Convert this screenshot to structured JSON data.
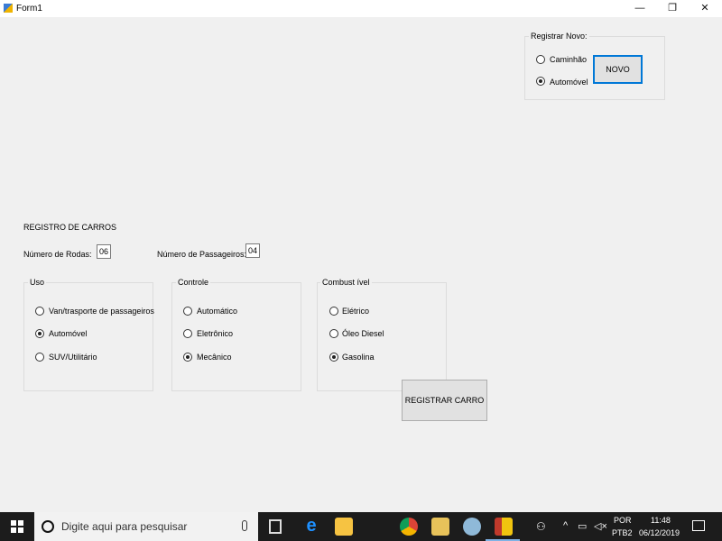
{
  "window": {
    "title": "Form1",
    "minimize": "—",
    "restore": "❐",
    "close": "✕"
  },
  "registrar_novo": {
    "legend": "Registrar Novo:",
    "options": [
      {
        "label": "Caminhão",
        "checked": false
      },
      {
        "label": "Automóvel",
        "checked": true
      }
    ],
    "button": "NOVO"
  },
  "registro": {
    "heading": "REGISTRO DE CARROS",
    "rodas_label": "Número de Rodas:",
    "rodas_value": "06",
    "passageiros_label": "Número de Passageiros:",
    "passageiros_value": "04"
  },
  "uso": {
    "legend": "Uso",
    "options": [
      {
        "label": "Van/trasporte de passageiros",
        "checked": false
      },
      {
        "label": "Automóvel",
        "checked": true
      },
      {
        "label": "SUV/Utilitário",
        "checked": false
      }
    ]
  },
  "controle": {
    "legend": "Controle",
    "options": [
      {
        "label": "Automático",
        "checked": false
      },
      {
        "label": "Eletrônico",
        "checked": false
      },
      {
        "label": "Mecânico",
        "checked": true
      }
    ]
  },
  "combustivel": {
    "legend": "Combust ível",
    "options": [
      {
        "label": "Elétrico",
        "checked": false
      },
      {
        "label": "Óleo Diesel",
        "checked": false
      },
      {
        "label": "Gasolina",
        "checked": true
      }
    ]
  },
  "registrar_button": "REGISTRAR CARRO",
  "taskbar": {
    "search_placeholder": "Digite aqui para pesquisar",
    "lang_top": "POR",
    "lang_bottom": "PTB2",
    "time": "11:48",
    "date": "06/12/2019"
  }
}
